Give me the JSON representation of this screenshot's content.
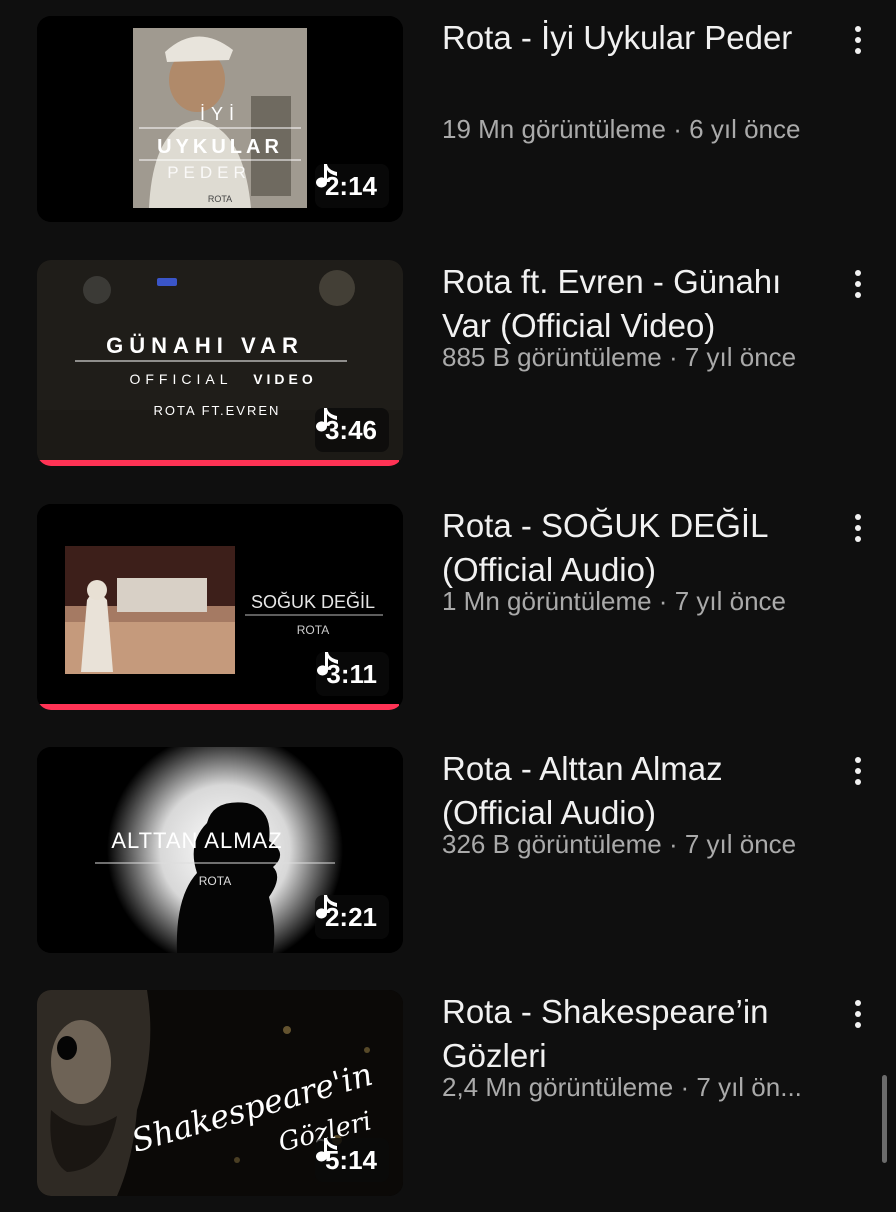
{
  "videos": [
    {
      "title": "Rota - İyi Uykular Peder",
      "views": "19 Mn görüntüleme",
      "age": "6 yıl önce",
      "duration": "2:14",
      "thumb_text": [
        "İYİ",
        "UYKULAR",
        "PEDER",
        "ROTA"
      ],
      "watched_fraction": 0
    },
    {
      "title": "Rota ft. Evren - Günahı Var (Official Video)",
      "views": "885 B görüntüleme",
      "age": "7 yıl önce",
      "duration": "3:46",
      "thumb_text": [
        "GÜNAHI VAR",
        "OFFICIAL",
        "VIDEO",
        "ROTA FT.EVREN"
      ],
      "watched_fraction": 0.99
    },
    {
      "title": "Rota - SOĞUK DEĞİL (Official Audio)",
      "views": "1 Mn görüntüleme",
      "age": "7 yıl önce",
      "duration": "3:11",
      "thumb_text": [
        "SOĞUK DEĞİL",
        "ROTA"
      ],
      "watched_fraction": 0.99
    },
    {
      "title": "Rota - Alttan Almaz (Official Audio)",
      "views": "326 B görüntüleme",
      "age": "7 yıl önce",
      "duration": "2:21",
      "thumb_text": [
        "ALTTAN ALMAZ",
        "ROTA"
      ],
      "watched_fraction": 0
    },
    {
      "title": "Rota - Shakespeare’in Gözleri",
      "views": "2,4 Mn görüntüleme",
      "age": "7 yıl ön...",
      "duration": "5:14",
      "thumb_text": [
        "Shakespeare'in",
        "Gözleri"
      ],
      "watched_fraction": 0
    }
  ],
  "meta_separator": "·",
  "icons": {
    "duration": "music-note-icon",
    "menu": "more-vert-icon"
  },
  "colors": {
    "progress": "#ff3355",
    "background": "#0f0f0f",
    "meta_text": "#aaaaaa"
  }
}
